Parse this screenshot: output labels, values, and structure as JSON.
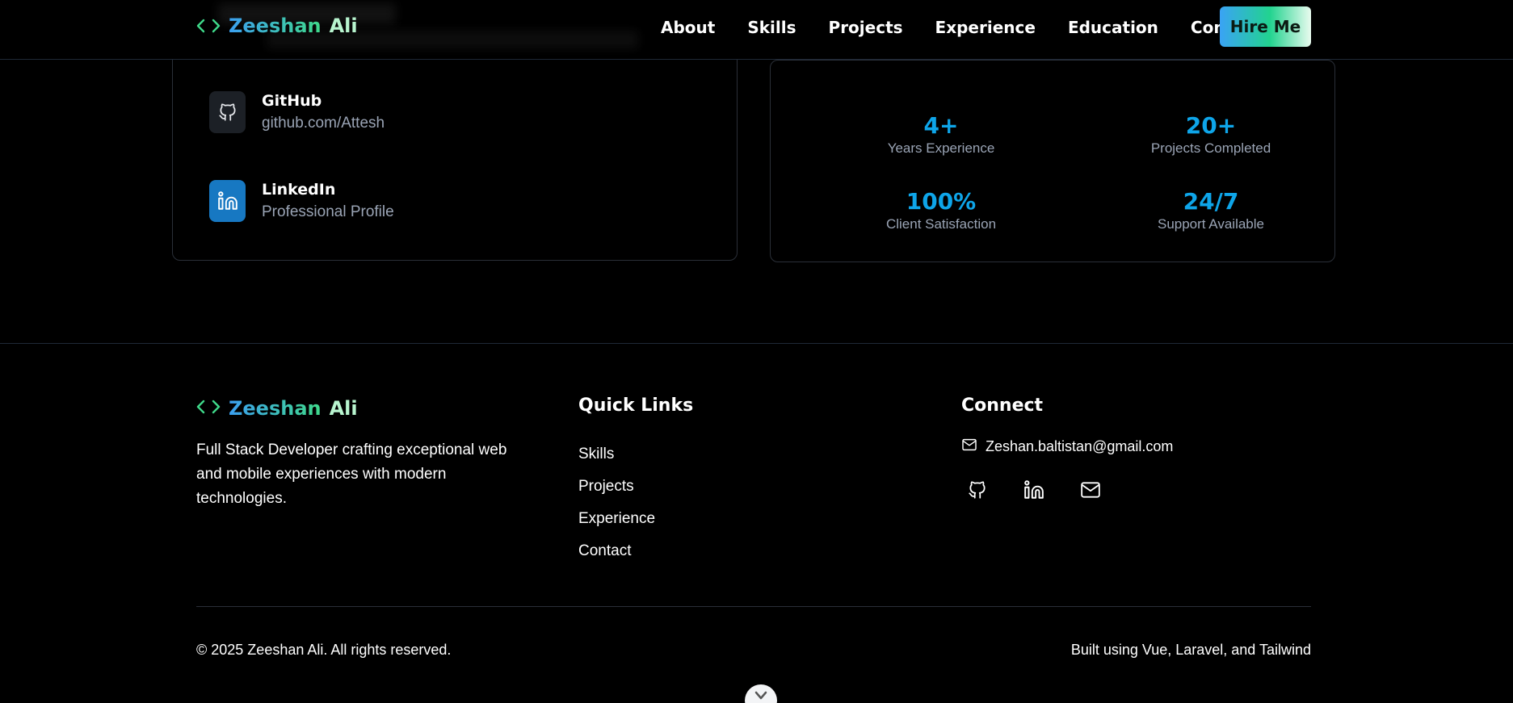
{
  "nav": {
    "brand_first": "Zeeshan",
    "brand_last": "Ali",
    "links": [
      "About",
      "Skills",
      "Projects",
      "Experience",
      "Education",
      "Contact"
    ],
    "hire_label": "Hire Me"
  },
  "contact_links": [
    {
      "icon": "github-icon",
      "title": "GitHub",
      "subtitle": "github.com/Attesh"
    },
    {
      "icon": "linkedin-icon",
      "title": "LinkedIn",
      "subtitle": "Professional Profile"
    }
  ],
  "stats": [
    {
      "value": "4+",
      "label": "Years Experience"
    },
    {
      "value": "20+",
      "label": "Projects Completed"
    },
    {
      "value": "100%",
      "label": "Client Satisfaction"
    },
    {
      "value": "24/7",
      "label": "Support Available"
    }
  ],
  "footer": {
    "brand_first": "Zeeshan",
    "brand_last": "Ali",
    "description": "Full Stack Developer crafting exceptional web and mobile experiences with modern technologies.",
    "quick_links_heading": "Quick Links",
    "quick_links": [
      "Skills",
      "Projects",
      "Experience",
      "Contact"
    ],
    "connect_heading": "Connect",
    "email": "Zeshan.baltistan@gmail.com",
    "social_icons": [
      "github-icon",
      "linkedin-icon",
      "mail-icon"
    ],
    "copyright": "© 2025 Zeeshan Ali. All rights reserved.",
    "built_with": "Built using Vue, Laravel, and Tailwind"
  },
  "colors": {
    "accent_blue": "#0ea5e9",
    "brand_green": "#3fd98a",
    "muted_text": "#9aa4b5",
    "linkedin_blue": "#1778c2"
  }
}
